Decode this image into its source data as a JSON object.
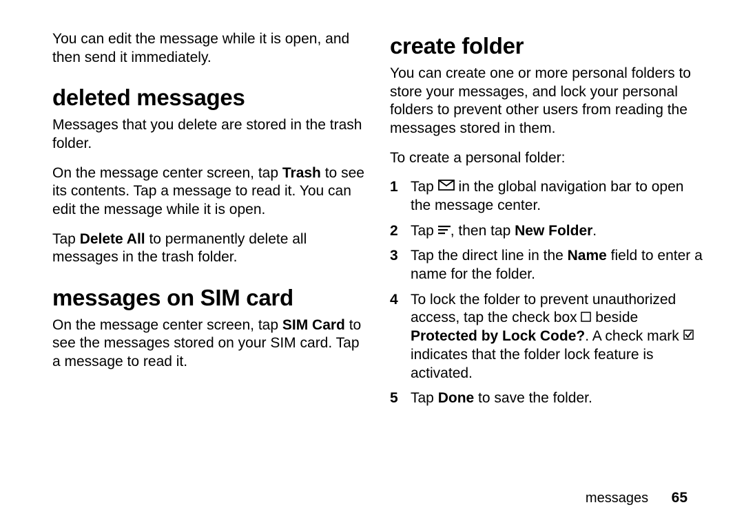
{
  "left": {
    "intro_para": "You can edit the message while it is open, and then send it immediately.",
    "deleted_heading": "deleted messages",
    "deleted_p1": "Messages that you delete are stored in the trash folder.",
    "deleted_p2_a": "On the message center screen, tap ",
    "deleted_p2_bold": "Trash",
    "deleted_p2_b": " to see its contents. Tap a message to read it. You can edit the message while it is open.",
    "deleted_p3_a": "Tap ",
    "deleted_p3_bold": "Delete All",
    "deleted_p3_b": " to permanently delete all messages in the trash folder.",
    "sim_heading": "messages on SIM card",
    "sim_p1_a": "On the message center screen, tap ",
    "sim_p1_bold": "SIM Card",
    "sim_p1_b": " to see the messages stored on your SIM card. Tap a message to read it."
  },
  "right": {
    "create_heading": "create folder",
    "create_p1": "You can create one or more personal folders to store your messages, and lock your personal folders to prevent other users from reading the messages stored in them.",
    "create_p2": "To create a personal folder:",
    "step1_a": "Tap ",
    "step1_b": " in the global navigation bar to open the message center.",
    "step2_a": "Tap ",
    "step2_b": ", then tap ",
    "step2_bold": "New Folder",
    "step2_c": ".",
    "step3_a": "Tap the direct line in the ",
    "step3_bold": "Name",
    "step3_b": " field to enter a name for the folder.",
    "step4_a": "To lock the folder to prevent unauthorized access, tap the check box ",
    "step4_b": " beside ",
    "step4_bold": "Protected by Lock Code?",
    "step4_c": ". A check mark ",
    "step4_d": " indicates that the folder lock feature is activated.",
    "step5_a": "Tap ",
    "step5_bold": "Done",
    "step5_b": " to save the folder."
  },
  "footer": {
    "section": "messages",
    "page": "65"
  }
}
